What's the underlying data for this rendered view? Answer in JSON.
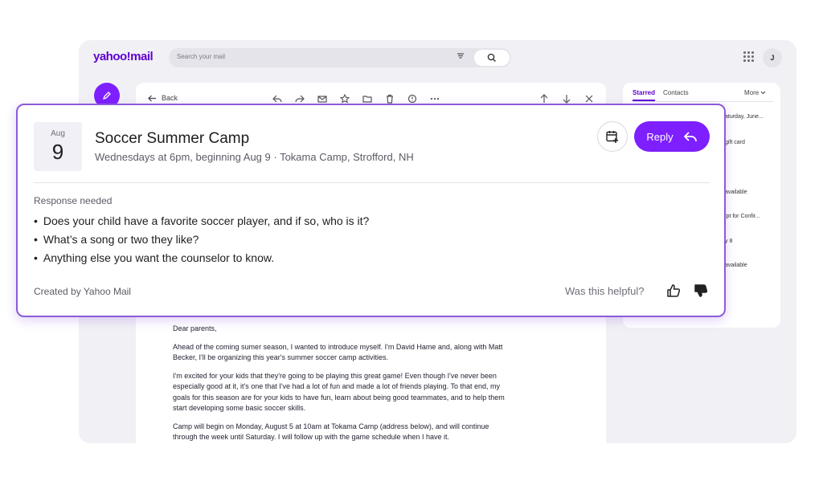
{
  "header": {
    "logo": "yahoo!mail",
    "search_placeholder": "Search your mail",
    "avatar_initial": "J"
  },
  "toolbar": {
    "back_label": "Back"
  },
  "side_panel": {
    "tabs": [
      "Starred",
      "Contacts"
    ],
    "more_label": "More",
    "snippets": [
      "aturday, June...",
      "gift card",
      "available",
      "ipt for Confir...",
      "y 8",
      "available"
    ]
  },
  "summary_card": {
    "date_month": "Aug",
    "date_day": "9",
    "title": "Soccer Summer Camp",
    "subtitle": "Wednesdays at 6pm, beginning Aug 9 · Tokama Camp, Strofford, NH",
    "reply_label": "Reply",
    "response_label": "Response needed",
    "questions": [
      "Does your child have a favorite soccer player, and if so, who is it?",
      "What’s a song or two they like?",
      "Anything else you want the counselor to know."
    ],
    "created_by": "Created by Yahoo Mail",
    "helpful_prompt": "Was this helpful?"
  },
  "email_body": {
    "paragraphs": [
      "Dear parents,",
      "Ahead of the coming sumer season, I wanted to introduce myself. I'm David Hame and, along with Matt Becker, I'll be organizing this year's summer soccer camp activities.",
      "I'm excited for your kids that they're going to be playing this great game! Even though I've never been especially good at it, it's one that I've had a lot of fun and made a lot of friends playing. To that end, my goals for this season are for your kids to have fun, learn about being good teammates, and to help them start developing some basic soccer skills.",
      "Camp will begin on Monday, August 5 at 10am at Tokama Camp (address below), and will continue through the week until Saturday. I will follow up with the game schedule when I have it."
    ]
  },
  "colors": {
    "brand_purple": "#6001d2",
    "button_purple": "#7e1fff",
    "card_border": "#8b5bd9"
  }
}
